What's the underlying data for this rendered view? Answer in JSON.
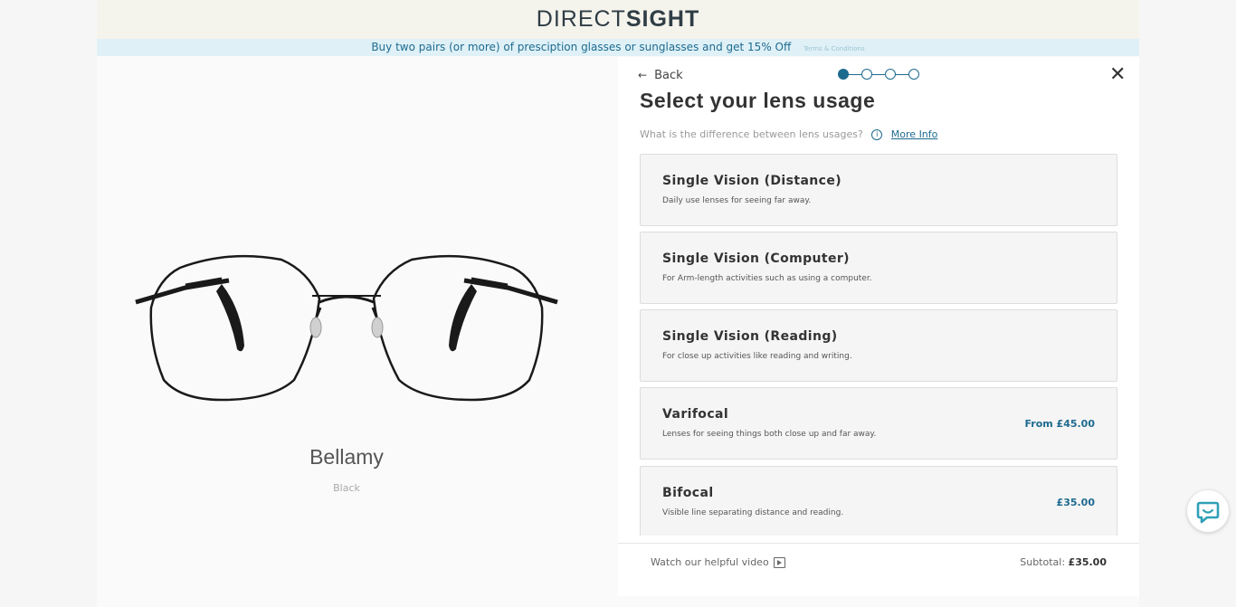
{
  "header": {
    "logo_thin": "DIRECT",
    "logo_bold": "SIGHT"
  },
  "promo": {
    "text": "Buy two pairs (or more) of presciption glasses or sunglasses and get 15% Off",
    "terms": "Terms & Conditions"
  },
  "product": {
    "name": "Bellamy",
    "color": "Black"
  },
  "panel": {
    "back_label": "Back",
    "title": "Select your lens usage",
    "question": "What is the difference between lens usages?",
    "more_info": "More Info",
    "steps_total": 4,
    "step_current": 1,
    "options": [
      {
        "name": "Single Vision (Distance)",
        "desc": "Daily use lenses for seeing far away.",
        "price": ""
      },
      {
        "name": "Single Vision (Computer)",
        "desc": "For Arm-length activities such as using a computer.",
        "price": ""
      },
      {
        "name": "Single Vision (Reading)",
        "desc": "For close up activities like reading and writing.",
        "price": ""
      },
      {
        "name": "Varifocal",
        "desc": "Lenses for seeing things both close up and far away.",
        "price": "From £45.00"
      },
      {
        "name": "Bifocal",
        "desc": "Visible line separating distance and reading.",
        "price": "£35.00"
      }
    ],
    "footer": {
      "video_label": "Watch our helpful video",
      "subtotal_label": "Subtotal:",
      "subtotal_value": "£35.00"
    }
  },
  "colors": {
    "accent": "#1d6a8f",
    "promo_bg": "#dff1f7",
    "header_bg": "#f4f3ec",
    "chat_accent": "#2fa0b6"
  },
  "icons": [
    "arrow-left-icon",
    "close-icon",
    "info-icon",
    "play-icon",
    "chat-icon"
  ]
}
